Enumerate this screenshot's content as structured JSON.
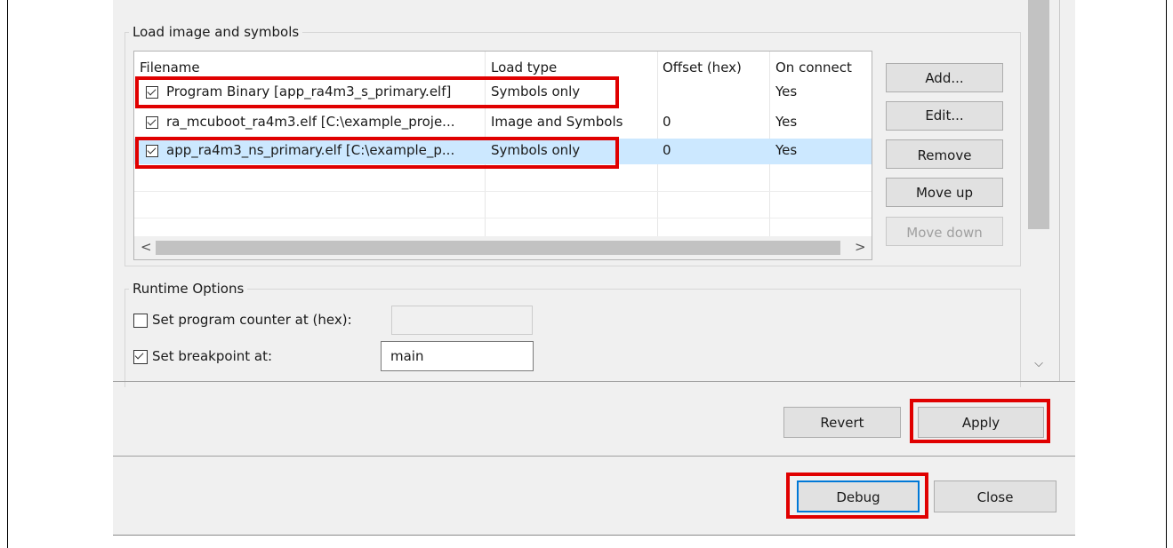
{
  "load_group": {
    "title": "Load image and symbols",
    "columns": [
      "Filename",
      "Load type",
      "Offset (hex)",
      "On connect"
    ],
    "rows": [
      {
        "checked": true,
        "filename": "Program Binary [app_ra4m3_s_primary.elf]",
        "load_type": "Symbols only",
        "offset": "",
        "on_connect": "Yes",
        "selected": false
      },
      {
        "checked": true,
        "filename": "ra_mcuboot_ra4m3.elf [C:\\example_proje...",
        "load_type": "Image and Symbols",
        "offset": "0",
        "on_connect": "Yes",
        "selected": false
      },
      {
        "checked": true,
        "filename": "app_ra4m3_ns_primary.elf [C:\\example_p...",
        "load_type": "Symbols only",
        "offset": "0",
        "on_connect": "Yes",
        "selected": true
      }
    ],
    "buttons": {
      "add": "Add...",
      "edit": "Edit...",
      "remove": "Remove",
      "move_up": "Move up",
      "move_down": "Move down"
    }
  },
  "runtime_group": {
    "title": "Runtime Options",
    "pc_label": "Set program counter at (hex):",
    "pc_checked": false,
    "pc_value": "",
    "bp_label": "Set breakpoint at:",
    "bp_checked": true,
    "bp_value": "main"
  },
  "apply_bar": {
    "revert": "Revert",
    "apply": "Apply"
  },
  "footer": {
    "debug": "Debug",
    "close": "Close"
  },
  "scroll": {
    "left": "<",
    "right": ">",
    "down": "⌵"
  },
  "colors": {
    "highlight": "#e00000",
    "selection": "#cce8ff",
    "focus": "#0078d7"
  }
}
